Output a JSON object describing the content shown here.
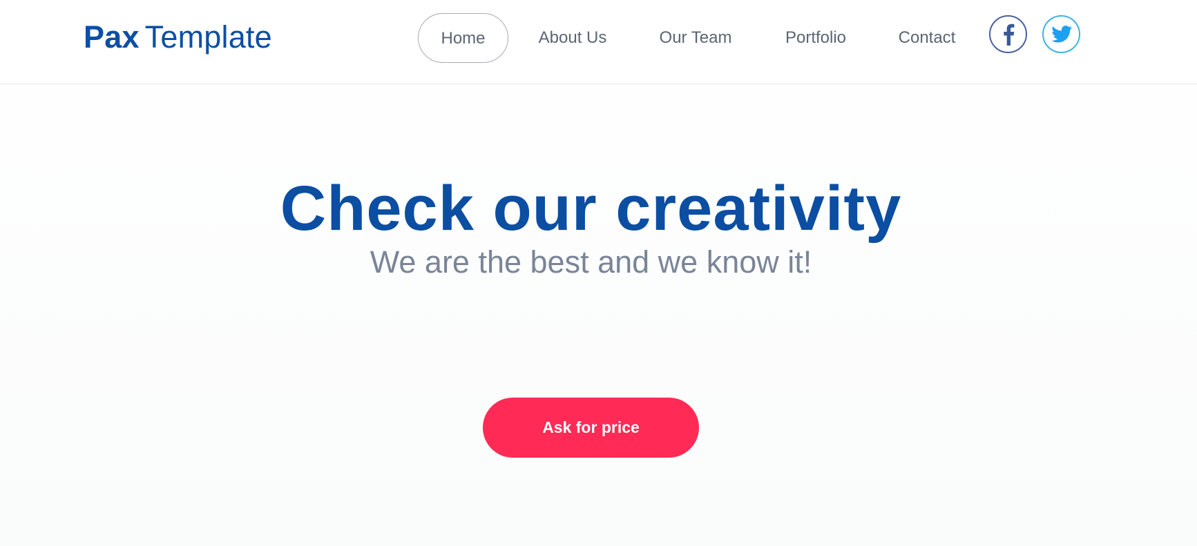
{
  "brand": {
    "strong": "Pax",
    "light": "Template",
    "color": "#0d4fa3"
  },
  "nav": {
    "items": [
      {
        "label": "Home",
        "active": true
      },
      {
        "label": "About Us",
        "active": false
      },
      {
        "label": "Our Team",
        "active": false
      },
      {
        "label": "Portfolio",
        "active": false
      },
      {
        "label": "Contact",
        "active": false
      }
    ]
  },
  "social": [
    {
      "icon": "facebook-icon",
      "color": "#3b5998"
    },
    {
      "icon": "twitter-icon",
      "color": "#1da1f2"
    }
  ],
  "hero": {
    "title": "Check our creativity",
    "subtitle": "We are the best and we know it!",
    "cta_label": "Ask for price",
    "cta_color": "#ff2a55",
    "title_color": "#0b4ea2"
  }
}
